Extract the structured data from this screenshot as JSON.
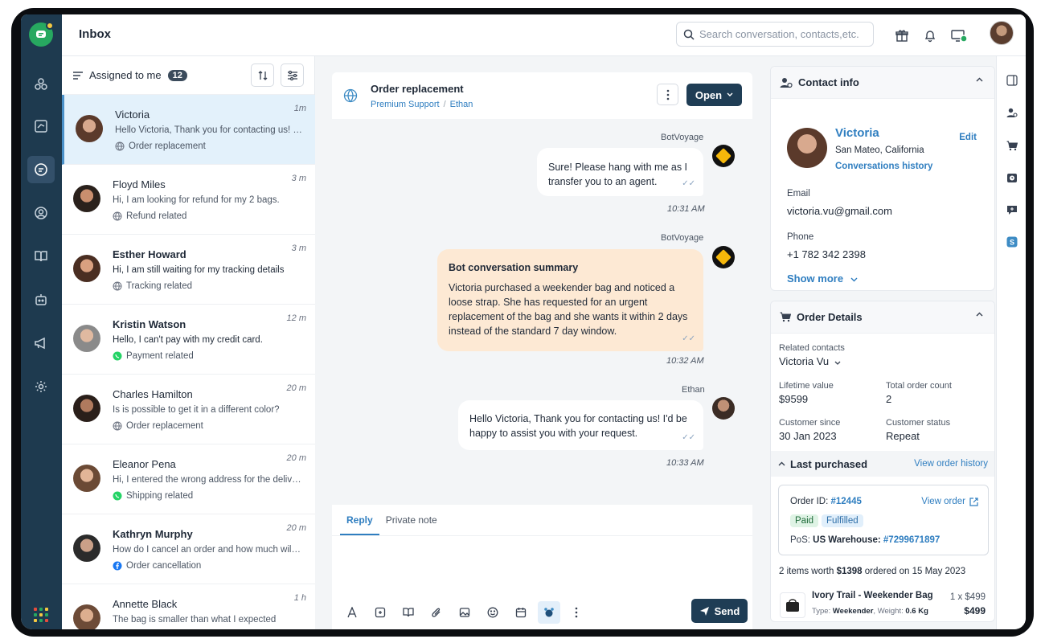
{
  "app": {
    "title": "Inbox"
  },
  "search": {
    "placeholder": "Search conversation, contacts,etc."
  },
  "list": {
    "filter_label": "Assigned to me",
    "count": "12",
    "conversations": [
      {
        "name": "Victoria",
        "time": "1m",
        "preview": "Hello Victoria, Thank you for contacting us! I'd be happy",
        "tag": "Order replacement",
        "channel": "web-icon",
        "bold": false
      },
      {
        "name": "Floyd Miles",
        "time": "3 m",
        "preview": "Hi, I am looking for refund for my 2 bags.",
        "tag": "Refund related",
        "channel": "web-icon",
        "bold": false
      },
      {
        "name": "Esther Howard",
        "time": "3 m",
        "preview": "Hi, I am still waiting for my tracking details",
        "tag": "Tracking related",
        "channel": "web-icon",
        "bold": true
      },
      {
        "name": "Kristin Watson",
        "time": "12 m",
        "preview": "Hello, I can't pay with my credit card.",
        "tag": "Payment related",
        "channel": "whatsapp-icon",
        "bold": true
      },
      {
        "name": "Charles Hamilton",
        "time": "20 m",
        "preview": "Is is possible to get it in a different color?",
        "tag": "Order replacement",
        "channel": "web-icon",
        "bold": false
      },
      {
        "name": "Eleanor Pena",
        "time": "20 m",
        "preview": "Hi, I entered the wrong address for the delivery",
        "tag": "Shipping related",
        "channel": "whatsapp-icon",
        "bold": false
      },
      {
        "name": "Kathryn Murphy",
        "time": "20 m",
        "preview": "How do I cancel an order and how much will it cost",
        "tag": "Order cancellation",
        "channel": "facebook-icon",
        "bold": true
      },
      {
        "name": "Annette Black",
        "time": "1 h",
        "preview": "The bag is smaller than what I expected",
        "tag": "",
        "channel": "",
        "bold": false
      }
    ]
  },
  "chat": {
    "subject": "Order replacement",
    "crumb_group": "Premium Support",
    "crumb_agent": "Ethan",
    "status_label": "Open",
    "messages": [
      {
        "sender": "BotVoyage",
        "text": "Sure! Please hang with me as I transfer you to an agent.",
        "time": "10:31 AM"
      },
      {
        "sender": "BotVoyage",
        "title": "Bot conversation summary",
        "text": "Victoria purchased a weekender bag and noticed a loose strap. She has requested for an urgent replacement of the bag and she wants it within 2 days instead of the standard 7 day window.",
        "time": "10:32 AM"
      },
      {
        "sender": "Ethan",
        "text": "Hello Victoria, Thank you for contacting us! I'd be happy to assist you with your request.",
        "time": "10:33 AM"
      }
    ],
    "composer": {
      "tab_reply": "Reply",
      "tab_note": "Private note",
      "send_label": "Send"
    }
  },
  "contact": {
    "header": "Contact info",
    "name": "Victoria",
    "location": "San Mateo, California",
    "history_link": "Conversations history",
    "edit_label": "Edit",
    "email_label": "Email",
    "email": "victoria.vu@gmail.com",
    "phone_label": "Phone",
    "phone": "+1 782 342 2398",
    "show_more": "Show more"
  },
  "order": {
    "header": "Order Details",
    "related_label": "Related contacts",
    "related_value": "Victoria Vu",
    "lifetime_label": "Lifetime value",
    "lifetime_value": "$9599",
    "total_label": "Total order count",
    "total_value": "2",
    "since_label": "Customer since",
    "since_value": "30 Jan 2023",
    "status_label": "Customer status",
    "status_value": "Repeat",
    "last_purchased": "Last purchased",
    "view_history": "View order history",
    "order_id_label": "Order ID:",
    "order_id": "#12445",
    "view_order": "View order",
    "pill_paid": "Paid",
    "pill_fulfilled": "Fulfilled",
    "pos_label": "PoS:",
    "pos_value": "US Warehouse:",
    "pos_id": "#7299671897",
    "summary_pre": "2 items worth",
    "summary_amount": "$1398",
    "summary_mid": "ordered on",
    "summary_date": "15 May 2023",
    "product_name": "Ivory Trail - Weekender Bag",
    "product_type_label": "Type:",
    "product_type": "Weekender",
    "product_weight_label": "Weight:",
    "product_weight": "0.6 Kg",
    "product_qty": "1 x $499",
    "product_total": "$499"
  },
  "colors": {
    "nav_bg": "#1e3a4f",
    "accent": "#2f7ec0",
    "primary_btn": "#1f3d55",
    "summary_bg": "#fde9d4",
    "active_row": "#e3f1fb"
  }
}
